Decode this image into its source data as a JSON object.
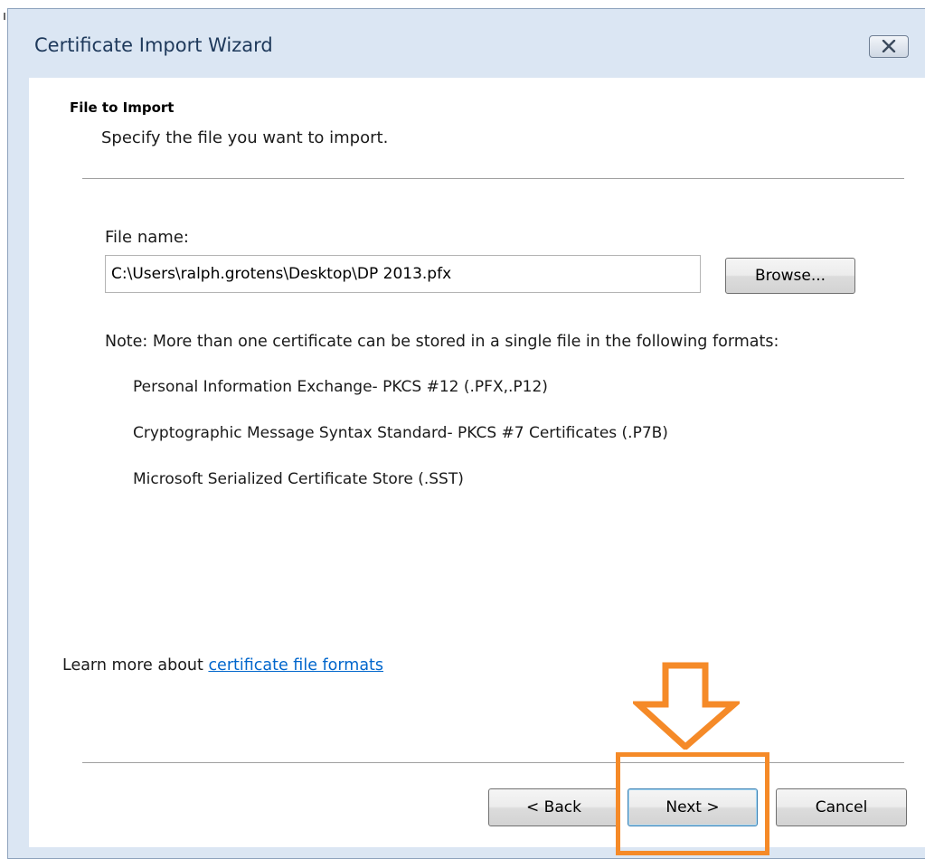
{
  "window": {
    "title": "Certificate Import Wizard"
  },
  "header": {
    "title": "File to Import",
    "subtitle": "Specify the file you want to import."
  },
  "file": {
    "label": "File name:",
    "value": "C:\\Users\\ralph.grotens\\Desktop\\DP 2013.pfx",
    "browse_label": "Browse..."
  },
  "note": {
    "text": "Note:  More than one certificate can be stored in a single file in the following formats:",
    "formats": [
      "Personal Information Exchange- PKCS #12 (.PFX,.P12)",
      "Cryptographic Message Syntax Standard- PKCS #7 Certificates (.P7B)",
      "Microsoft Serialized Certificate Store (.SST)"
    ]
  },
  "learn_more": {
    "prefix": "Learn more about ",
    "link_text": "certificate file formats"
  },
  "footer": {
    "back_label": "< Back",
    "next_label": "Next >",
    "cancel_label": "Cancel"
  },
  "icons": {
    "close": "close-x-icon",
    "annotation": "orange-down-arrow-icon"
  },
  "colors": {
    "annotation": "#f58a28",
    "link": "#0066cc",
    "frame": "#dbe6f3"
  }
}
